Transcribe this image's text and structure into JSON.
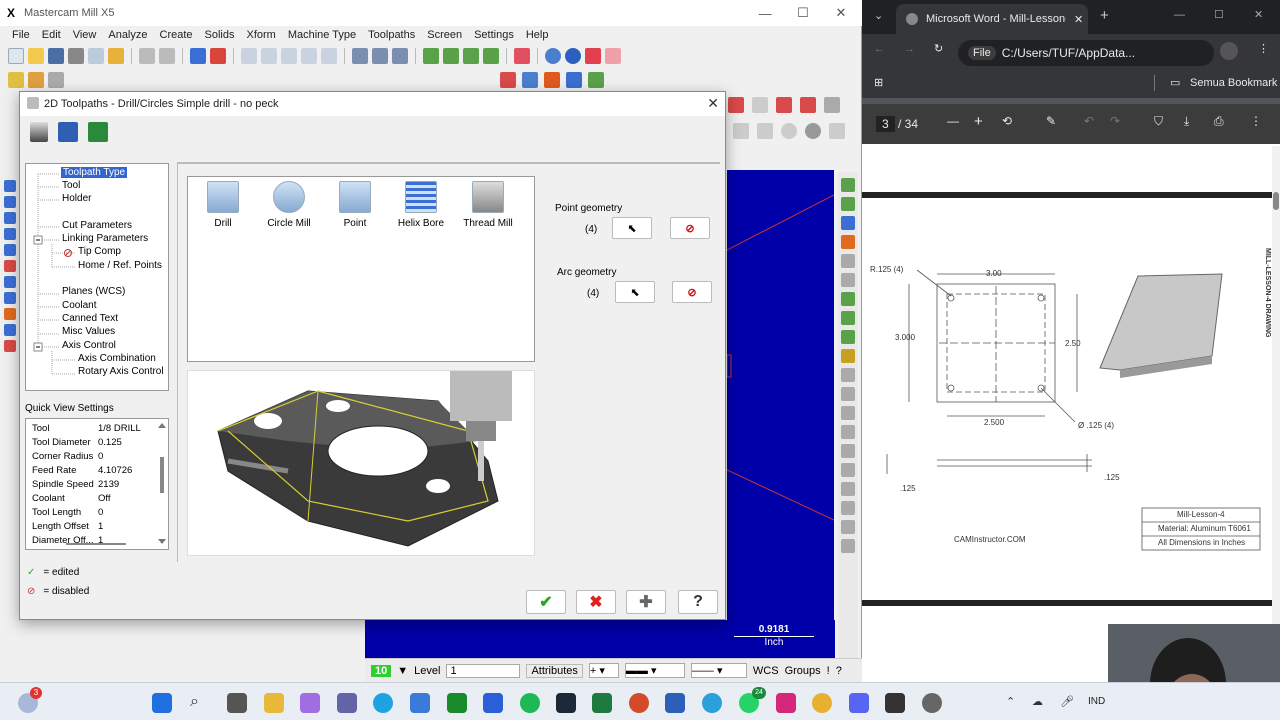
{
  "mastercam": {
    "title": "Mastercam Mill X5",
    "menu": [
      "File",
      "Edit",
      "View",
      "Analyze",
      "Create",
      "Solids",
      "Xform",
      "Machine Type",
      "Toolpaths",
      "Screen",
      "Settings",
      "Help"
    ]
  },
  "dialog": {
    "title": "2D Toolpaths - Drill/Circles Simple drill - no peck",
    "tree": [
      {
        "label": "Toolpath Type",
        "selected": true
      },
      {
        "label": "Tool"
      },
      {
        "label": "Holder"
      },
      {
        "label": "Cut Parameters"
      },
      {
        "label": "Linking Parameters"
      },
      {
        "label": "Tip Comp"
      },
      {
        "label": "Home / Ref. Points"
      },
      {
        "label": "Planes (WCS)"
      },
      {
        "label": "Coolant"
      },
      {
        "label": "Canned Text"
      },
      {
        "label": "Misc Values"
      },
      {
        "label": "Axis Control"
      },
      {
        "label": "Axis Combination"
      },
      {
        "label": "Rotary Axis Control"
      }
    ],
    "quick_view_label": "Quick View Settings",
    "quick_view": [
      {
        "k": "Tool",
        "v": "1/8 DRILL"
      },
      {
        "k": "Tool Diameter",
        "v": "0.125"
      },
      {
        "k": "Corner Radius",
        "v": "0"
      },
      {
        "k": "Feed Rate",
        "v": "4.10726"
      },
      {
        "k": "Spindle Speed",
        "v": "2139"
      },
      {
        "k": "Coolant",
        "v": "Off"
      },
      {
        "k": "Tool Length",
        "v": "0"
      },
      {
        "k": "Length Offset",
        "v": "1"
      },
      {
        "k": "Diameter Off...",
        "v": "1"
      }
    ],
    "legend_edited": "= edited",
    "legend_disabled": "= disabled",
    "types": [
      "Drill",
      "Circle Mill",
      "Point",
      "Helix Bore",
      "Thread Mill"
    ],
    "point_geometry": "Point geometry",
    "point_count": "(4)",
    "arc_geometry": "Arc geometry",
    "arc_count": "(4)"
  },
  "status": {
    "level_label": "Level",
    "level_value": "1",
    "level_num": "10",
    "attributes": "Attributes",
    "wcs": "WCS",
    "groups": "Groups",
    "scale_value": "0.9181",
    "scale_unit": "Inch"
  },
  "browser": {
    "tab_title": "Microsoft Word - Mill-Lesson-4",
    "url": "C:/Users/TUF/AppData...",
    "file_label": "File",
    "bookmarks": "Semua Bookmark",
    "page_current": "3",
    "page_total": "/ 34"
  },
  "drawing": {
    "r125": "R.125  (4)",
    "w300": "3.00",
    "h3000": "3.000",
    "h250": "2.50",
    "w2500": "2.500",
    "dia": "Ø .125  (4)",
    "t125a": ".125",
    "t125b": ".125",
    "side_title": "MILL-LESSON-4 DRAWING",
    "box1": "Mill-Lesson-4",
    "box2": "Material: Aluminum T6061",
    "box3": "All Dimensions in Inches",
    "site": "CAMInstructor.COM"
  },
  "taskbar": {
    "lang": "IND",
    "badge1": "3",
    "badge2": "24"
  }
}
